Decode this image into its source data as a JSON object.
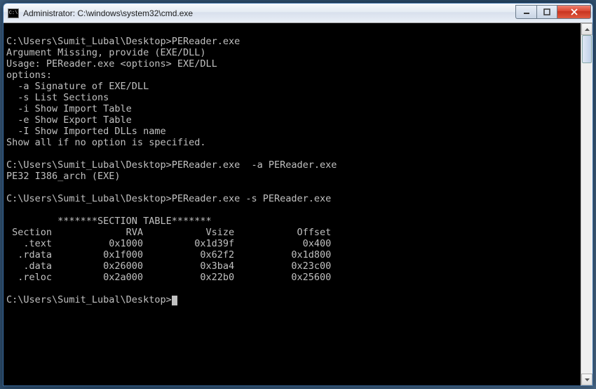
{
  "window": {
    "title": "Administrator: C:\\windows\\system32\\cmd.exe",
    "icon_text": "C:\\"
  },
  "term": {
    "line1": "C:\\Users\\Sumit_Lubal\\Desktop>PEReader.exe",
    "line2": "Argument Missing, provide (EXE/DLL)",
    "line3": "Usage: PEReader.exe <options> EXE/DLL",
    "line4": "options:",
    "line5": "  -a Signature of EXE/DLL",
    "line6": "  -s List Sections",
    "line7": "  -i Show Import Table",
    "line8": "  -e Show Export Table",
    "line9": "  -I Show Imported DLLs name",
    "line10": "Show all if no option is specified.",
    "blank1": "",
    "line11": "C:\\Users\\Sumit_Lubal\\Desktop>PEReader.exe  -a PEReader.exe",
    "line12": "PE32 I386_arch (EXE)",
    "blank2": "",
    "line13": "C:\\Users\\Sumit_Lubal\\Desktop>PEReader.exe -s PEReader.exe",
    "blank3": "",
    "line14": "         *******SECTION TABLE*******",
    "line15": " Section             RVA           Vsize           Offset",
    "line16": "   .text          0x1000         0x1d39f            0x400",
    "line17": "  .rdata         0x1f000          0x62f2          0x1d800",
    "line18": "   .data         0x26000          0x3ba4          0x23c00",
    "line19": "  .reloc         0x2a000          0x22b0          0x25600",
    "blank4": "",
    "line20": "C:\\Users\\Sumit_Lubal\\Desktop>"
  },
  "section_table": {
    "header": [
      "Section",
      "RVA",
      "Vsize",
      "Offset"
    ],
    "rows": [
      {
        "section": ".text",
        "rva": "0x1000",
        "vsize": "0x1d39f",
        "offset": "0x400"
      },
      {
        "section": ".rdata",
        "rva": "0x1f000",
        "vsize": "0x62f2",
        "offset": "0x1d800"
      },
      {
        "section": ".data",
        "rva": "0x26000",
        "vsize": "0x3ba4",
        "offset": "0x23c00"
      },
      {
        "section": ".reloc",
        "rva": "0x2a000",
        "vsize": "0x22b0",
        "offset": "0x25600"
      }
    ]
  }
}
